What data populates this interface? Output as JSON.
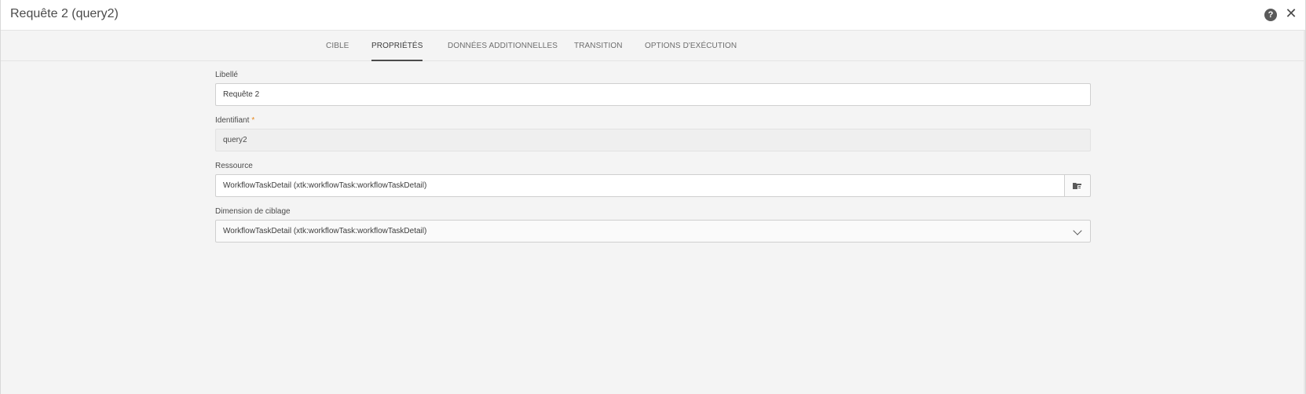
{
  "window": {
    "title": "Requête 2 (query2)"
  },
  "icons": {
    "help": "help-icon",
    "close": "close-icon",
    "picker": "folder-icon",
    "dropdown": "chevron-down-icon"
  },
  "tabs": [
    {
      "label": "CIBLE",
      "active": false
    },
    {
      "label": "PROPRIÉTÉS",
      "active": true
    },
    {
      "label": "DONNÉES ADDITIONNELLES",
      "active": false
    },
    {
      "label": "TRANSITION",
      "active": false
    },
    {
      "label": "OPTIONS D'EXÉCUTION",
      "active": false
    }
  ],
  "form": {
    "label_field": {
      "label": "Libellé",
      "value": "Requête 2"
    },
    "id_field": {
      "label": "Identifiant",
      "required_mark": "*",
      "value": "query2"
    },
    "resource_field": {
      "label": "Ressource",
      "value": "WorkflowTaskDetail (xtk:workflowTask:workflowTaskDetail)"
    },
    "targeting_field": {
      "label": "Dimension de ciblage",
      "value": "WorkflowTaskDetail (xtk:workflowTask:workflowTaskDetail)"
    }
  },
  "colors": {
    "background": "#f4f4f4",
    "titlebar": "#ffffff",
    "required": "#e68619"
  }
}
